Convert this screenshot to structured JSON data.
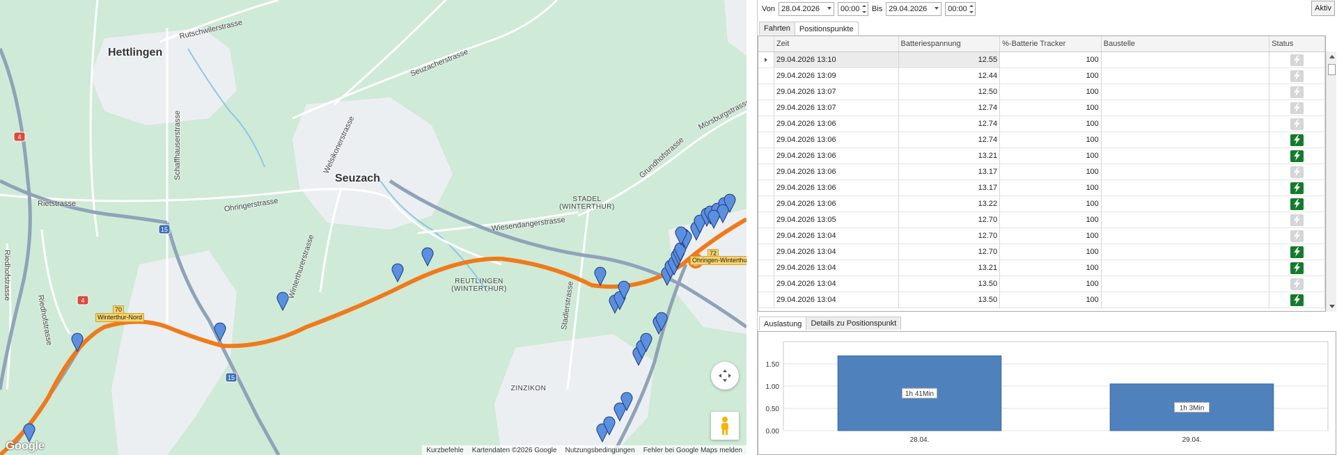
{
  "map": {
    "places_big": [
      {
        "name": "Hettlingen",
        "x": 193,
        "y": 77
      },
      {
        "name": "Seuzach",
        "x": 519,
        "y": 258
      }
    ],
    "places_small": [
      {
        "lines": [
          "STADEL",
          "(WINTERTHUR)"
        ],
        "x": 843,
        "y": 281
      },
      {
        "lines": [
          "REUTLINGEN",
          "(WINTERTHUR)"
        ],
        "x": 688,
        "y": 399
      },
      {
        "lines": [
          "ZINZIKON"
        ],
        "x": 759,
        "y": 553
      }
    ],
    "streets": [
      {
        "name": "Rutschwilerstrasse",
        "x": 258,
        "y": 54,
        "rot": -13
      },
      {
        "name": "Seuzacherstrasse",
        "x": 590,
        "y": 108,
        "rot": -22
      },
      {
        "name": "Rietstrasse",
        "x": 54,
        "y": 294,
        "rot": 0
      },
      {
        "name": "Ohringerstrasse",
        "x": 322,
        "y": 302,
        "rot": -9
      },
      {
        "name": "Welsikonerstrasse",
        "x": 468,
        "y": 250,
        "rot": -65
      },
      {
        "name": "Wiesendangerstrasse",
        "x": 706,
        "y": 330,
        "rot": -7
      },
      {
        "name": "Grundhofstrasse",
        "x": 920,
        "y": 255,
        "rot": -42
      },
      {
        "name": "Mörsburgstrasse",
        "x": 1004,
        "y": 185,
        "rot": -28
      },
      {
        "name": "Schaffhauserstrasse",
        "x": 255,
        "y": 260,
        "rot": -90
      },
      {
        "name": "Winterthurerstrasse",
        "x": 418,
        "y": 430,
        "rot": -72
      },
      {
        "name": "Riedhofstrasse",
        "x": 10,
        "y": 360,
        "rot": 90
      },
      {
        "name": "Riedhofstrasse",
        "x": 58,
        "y": 425,
        "rot": 80
      },
      {
        "name": "Stadlerstrasse",
        "x": 810,
        "y": 475,
        "rot": -82
      }
    ],
    "exits": [
      {
        "label": "70",
        "x": 162,
        "y": 439
      },
      {
        "label": "Winterthur-Nord",
        "x": 137,
        "y": 450
      },
      {
        "label": "72",
        "x": 1016,
        "y": 358
      },
      {
        "label": "Ohringen-Winterthur",
        "x": 991,
        "y": 368
      }
    ],
    "route_shields": [
      {
        "num": "4",
        "x": 28,
        "y": 197,
        "color": "#d94b3b"
      },
      {
        "num": "4",
        "x": 119,
        "y": 432,
        "color": "#d94b3b"
      },
      {
        "num": "15",
        "x": 236,
        "y": 330,
        "color": "#3a6fb5"
      },
      {
        "num": "15",
        "x": 332,
        "y": 543,
        "color": "#3a6fb5"
      }
    ],
    "footer": {
      "shortcuts": "Kurzbefehle",
      "mapdata": "Kartendaten ©2026 Google",
      "terms": "Nutzungsbedingungen",
      "report": "Fehler bei Google Maps melden"
    },
    "logo": "Google",
    "route_color": "#f07a1a",
    "marker_color": "#5b8fe0"
  },
  "filter": {
    "von_label": "Von",
    "von_date": "28.04.2026",
    "von_time": "00:00",
    "bis_label": "Bis",
    "bis_date": "29.04.2026",
    "bis_time": "00:00",
    "aktiv": "Aktiv"
  },
  "top_tabs": [
    "Fahrten",
    "Positionspunkte"
  ],
  "grid": {
    "columns": [
      "Zeit",
      "Batteriespannung",
      "%-Batterie Tracker",
      "Baustelle",
      "Status"
    ],
    "rows": [
      {
        "zeit": "29.04.2026 13:10",
        "batt": "12.55",
        "pct": "100",
        "status": "off"
      },
      {
        "zeit": "29.04.2026 13:09",
        "batt": "12.44",
        "pct": "100",
        "status": "off"
      },
      {
        "zeit": "29.04.2026 13:07",
        "batt": "12.50",
        "pct": "100",
        "status": "off"
      },
      {
        "zeit": "29.04.2026 13:07",
        "batt": "12.74",
        "pct": "100",
        "status": "off"
      },
      {
        "zeit": "29.04.2026 13:06",
        "batt": "12.74",
        "pct": "100",
        "status": "off"
      },
      {
        "zeit": "29.04.2026 13:06",
        "batt": "12.74",
        "pct": "100",
        "status": "on"
      },
      {
        "zeit": "29.04.2026 13:06",
        "batt": "13.21",
        "pct": "100",
        "status": "on"
      },
      {
        "zeit": "29.04.2026 13:06",
        "batt": "13.17",
        "pct": "100",
        "status": "off"
      },
      {
        "zeit": "29.04.2026 13:06",
        "batt": "13.17",
        "pct": "100",
        "status": "on"
      },
      {
        "zeit": "29.04.2026 13:06",
        "batt": "13.22",
        "pct": "100",
        "status": "on"
      },
      {
        "zeit": "29.04.2026 13:05",
        "batt": "12.70",
        "pct": "100",
        "status": "off"
      },
      {
        "zeit": "29.04.2026 13:04",
        "batt": "12.70",
        "pct": "100",
        "status": "off"
      },
      {
        "zeit": "29.04.2026 13:04",
        "batt": "12.70",
        "pct": "100",
        "status": "on"
      },
      {
        "zeit": "29.04.2026 13:04",
        "batt": "13.21",
        "pct": "100",
        "status": "on"
      },
      {
        "zeit": "29.04.2026 13:04",
        "batt": "13.50",
        "pct": "100",
        "status": "off"
      },
      {
        "zeit": "29.04.2026 13:04",
        "batt": "13.50",
        "pct": "100",
        "status": "on"
      }
    ],
    "status_on_color": "#167a2c",
    "status_off_color": "#d6d6d6"
  },
  "bottom_tabs": [
    "Auslastung",
    "Details zu Positionspunkt"
  ],
  "chart_data": {
    "type": "bar",
    "categories": [
      "28.04.",
      "29.04."
    ],
    "values": [
      1.68,
      1.05
    ],
    "data_labels": [
      "1h 41Min",
      "1h 3Min"
    ],
    "ylim": [
      0,
      2.0
    ],
    "yticks": [
      "0.00",
      "0.50",
      "1.00",
      "1.50"
    ],
    "bar_color": "#4f81bd",
    "grid": true
  }
}
